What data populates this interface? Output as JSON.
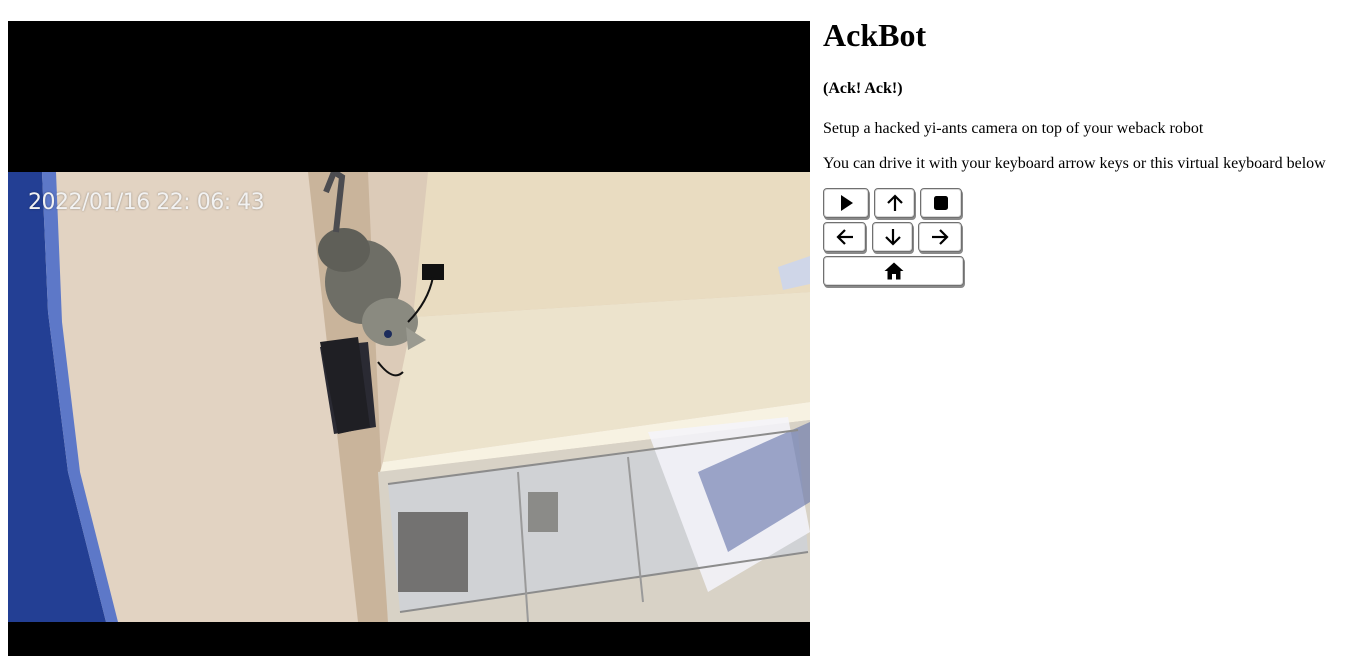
{
  "camera": {
    "timestamp": "2022/01/16 22: 06: 43"
  },
  "header": {
    "title": "AckBot",
    "subtitle": "(Ack! Ack!)"
  },
  "description": {
    "line1": "Setup a hacked yi-ants camera on top of your weback robot",
    "line2": "You can drive it with your keyboard arrow keys or this virtual keyboard below"
  },
  "keyboard": {
    "buttons": [
      {
        "action": "play",
        "icon": "play-icon"
      },
      {
        "action": "forward",
        "icon": "arrow-up-icon"
      },
      {
        "action": "stop",
        "icon": "stop-icon"
      },
      {
        "action": "left",
        "icon": "arrow-left-icon"
      },
      {
        "action": "backward",
        "icon": "arrow-down-icon"
      },
      {
        "action": "right",
        "icon": "arrow-right-icon"
      },
      {
        "action": "home",
        "icon": "home-icon"
      }
    ]
  }
}
